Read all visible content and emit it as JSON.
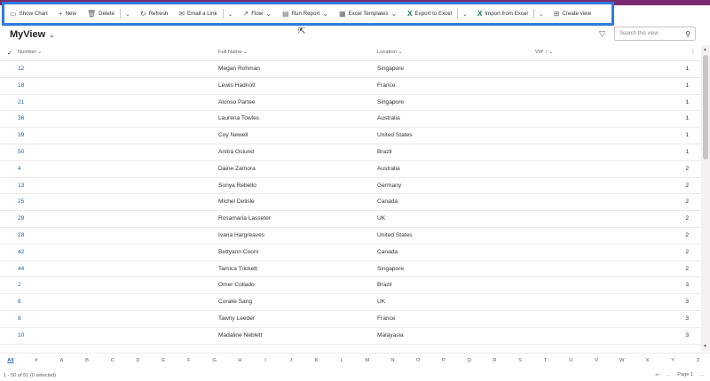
{
  "commandbar": {
    "show_chart": "Show Chart",
    "new": "New",
    "delete": "Delete",
    "refresh": "Refresh",
    "email_link": "Email a Link",
    "flow": "Flow",
    "run_report": "Run Report",
    "excel_templates": "Excel Templates",
    "export_excel": "Export to Excel",
    "import_excel": "Import from Excel",
    "create_view": "Create view"
  },
  "view": {
    "title": "MyView"
  },
  "search": {
    "placeholder": "Search this view"
  },
  "columns": {
    "number": "Number",
    "full_name": "Full Name",
    "location": "Location",
    "vip": "VIP"
  },
  "rows": [
    {
      "number": "12",
      "name": "Megan Rohman",
      "location": "Singapore",
      "vip": "1"
    },
    {
      "number": "18",
      "name": "Lewis Hadnott",
      "location": "France",
      "vip": "1"
    },
    {
      "number": "21",
      "name": "Alonso Partee",
      "location": "Singapore",
      "vip": "1"
    },
    {
      "number": "36",
      "name": "Laurena Towles",
      "location": "Australia",
      "vip": "1"
    },
    {
      "number": "39",
      "name": "Coy Newell",
      "location": "United States",
      "vip": "1"
    },
    {
      "number": "50",
      "name": "Anitra Oslund",
      "location": "Brazil",
      "vip": "1"
    },
    {
      "number": "4",
      "name": "Daine Zamora",
      "location": "Australia",
      "vip": "2"
    },
    {
      "number": "13",
      "name": "Sonya Rebello",
      "location": "Germany",
      "vip": "2"
    },
    {
      "number": "25",
      "name": "Michel Delisle",
      "location": "Canada",
      "vip": "2"
    },
    {
      "number": "29",
      "name": "Rosamaria Lasseter",
      "location": "UK",
      "vip": "2"
    },
    {
      "number": "28",
      "name": "Ivana Hargreaves",
      "location": "United States",
      "vip": "2"
    },
    {
      "number": "42",
      "name": "Bettyann Cooni",
      "location": "Canada",
      "vip": "2"
    },
    {
      "number": "44",
      "name": "Tamica Trickett",
      "location": "Singapore",
      "vip": "2"
    },
    {
      "number": "2",
      "name": "Omer Collado",
      "location": "Brazil",
      "vip": "3"
    },
    {
      "number": "6",
      "name": "Coralie Sang",
      "location": "UK",
      "vip": "3"
    },
    {
      "number": "8",
      "name": "Tawny Leeder",
      "location": "France",
      "vip": "3"
    },
    {
      "number": "10",
      "name": "Madaline Neblett",
      "location": "Malayasia",
      "vip": "3"
    }
  ],
  "alphabet": [
    "All",
    "#",
    "A",
    "B",
    "C",
    "D",
    "E",
    "F",
    "G",
    "H",
    "I",
    "J",
    "K",
    "L",
    "M",
    "N",
    "O",
    "P",
    "Q",
    "R",
    "S",
    "T",
    "U",
    "V",
    "W",
    "X",
    "Y",
    "Z"
  ],
  "footer": {
    "count": "1 - 50 of 51 (0 selected)",
    "page": "Page 1"
  },
  "colors": {
    "accent": "#2f7be0",
    "link": "#2266a8",
    "excel": "#107c41",
    "topstrip": "#7a2b6e"
  }
}
